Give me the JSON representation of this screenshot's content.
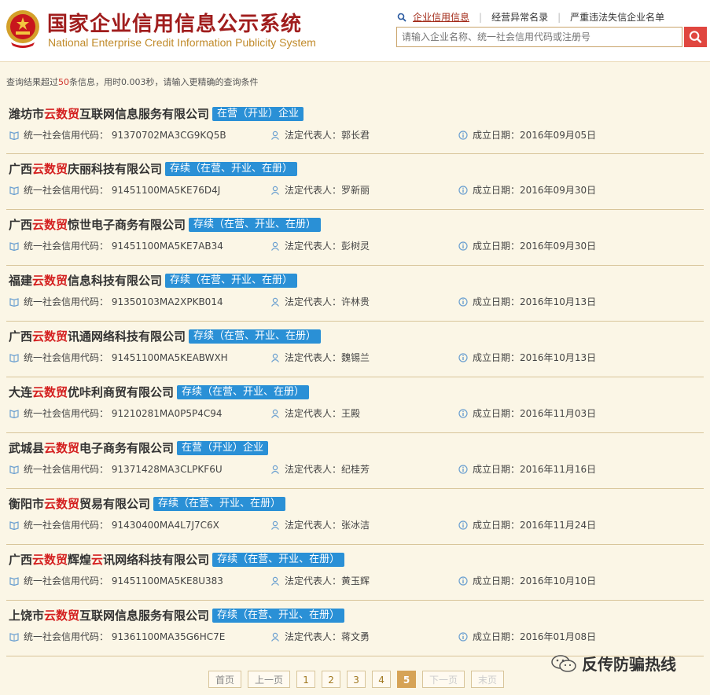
{
  "header": {
    "title_cn": "国家企业信用信息公示系统",
    "title_en": "National Enterprise Credit Information Publicity System",
    "nav": [
      "企业信用信息",
      "经营异常名录",
      "严重违法失信企业名单"
    ],
    "search_placeholder": "请输入企业名称、统一社会信用代码或注册号"
  },
  "summary": {
    "prefix": "查询结果超过",
    "count": "50",
    "suffix": "条信息，用时0.003秒，请输入更精确的查询条件"
  },
  "labels": {
    "code": "统一社会信用代码：",
    "rep": "法定代表人：",
    "date": "成立日期："
  },
  "results": [
    {
      "name": [
        [
          "潍坊市",
          0
        ],
        [
          "云数贸",
          1
        ],
        [
          "互联网信息服务有限公司",
          0
        ]
      ],
      "status": "在营（开业）企业",
      "code": "91370702MA3CG9KQ5B",
      "rep": "郭长君",
      "date": "2016年09月05日"
    },
    {
      "name": [
        [
          "广西",
          0
        ],
        [
          "云数贸",
          1
        ],
        [
          "庆丽科技有限公司",
          0
        ]
      ],
      "status": "存续（在营、开业、在册）",
      "code": "91451100MA5KE76D4J",
      "rep": "罗新丽",
      "date": "2016年09月30日"
    },
    {
      "name": [
        [
          "广西",
          0
        ],
        [
          "云数贸",
          1
        ],
        [
          "惊世电子商务有限公司",
          0
        ]
      ],
      "status": "存续（在营、开业、在册）",
      "code": "91451100MA5KE7AB34",
      "rep": "彭树灵",
      "date": "2016年09月30日"
    },
    {
      "name": [
        [
          "福建",
          0
        ],
        [
          "云数贸",
          1
        ],
        [
          "信息科技有限公司",
          0
        ]
      ],
      "status": "存续（在营、开业、在册）",
      "code": "91350103MA2XPKB014",
      "rep": "许林贵",
      "date": "2016年10月13日"
    },
    {
      "name": [
        [
          "广西",
          0
        ],
        [
          "云数贸",
          1
        ],
        [
          "讯通网络科技有限公司",
          0
        ]
      ],
      "status": "存续（在营、开业、在册）",
      "code": "91451100MA5KEABWXH",
      "rep": "魏锡兰",
      "date": "2016年10月13日"
    },
    {
      "name": [
        [
          "大连",
          0
        ],
        [
          "云数贸",
          1
        ],
        [
          "优咔利商贸有限公司",
          0
        ]
      ],
      "status": "存续（在营、开业、在册）",
      "code": "91210281MA0P5P4C94",
      "rep": "王殿",
      "date": "2016年11月03日"
    },
    {
      "name": [
        [
          "武城县",
          0
        ],
        [
          "云数贸",
          1
        ],
        [
          "电子商务有限公司",
          0
        ]
      ],
      "status": "在营（开业）企业",
      "code": "91371428MA3CLPKF6U",
      "rep": "纪桂芳",
      "date": "2016年11月16日"
    },
    {
      "name": [
        [
          "衡阳市",
          0
        ],
        [
          "云数贸",
          1
        ],
        [
          "贸易有限公司",
          0
        ]
      ],
      "status": "存续（在营、开业、在册）",
      "code": "91430400MA4L7J7C6X",
      "rep": "张冰洁",
      "date": "2016年11月24日"
    },
    {
      "name": [
        [
          "广西",
          0
        ],
        [
          "云数贸",
          1
        ],
        [
          "辉煌",
          0
        ],
        [
          "云",
          1
        ],
        [
          "讯网络科技有限公司",
          0
        ]
      ],
      "status": "存续（在营、开业、在册）",
      "code": "91451100MA5KE8U383",
      "rep": "黄玉辉",
      "date": "2016年10月10日"
    },
    {
      "name": [
        [
          "上饶市",
          0
        ],
        [
          "云数贸",
          1
        ],
        [
          "互联网信息服务有限公司",
          0
        ]
      ],
      "status": "存续（在营、开业、在册）",
      "code": "91361100MA35G6HC7E",
      "rep": "蒋文勇",
      "date": "2016年01月08日"
    }
  ],
  "pager": {
    "first": "首页",
    "prev": "上一页",
    "pages": [
      "1",
      "2",
      "3",
      "4",
      "5"
    ],
    "current": "5",
    "next": "下一页",
    "last": "末页"
  },
  "watermark": "反传防骗热线",
  "colors": {
    "keyword": "#d41f1f",
    "status_bg": "#2a90d6",
    "brand_red": "#a01d1d"
  }
}
